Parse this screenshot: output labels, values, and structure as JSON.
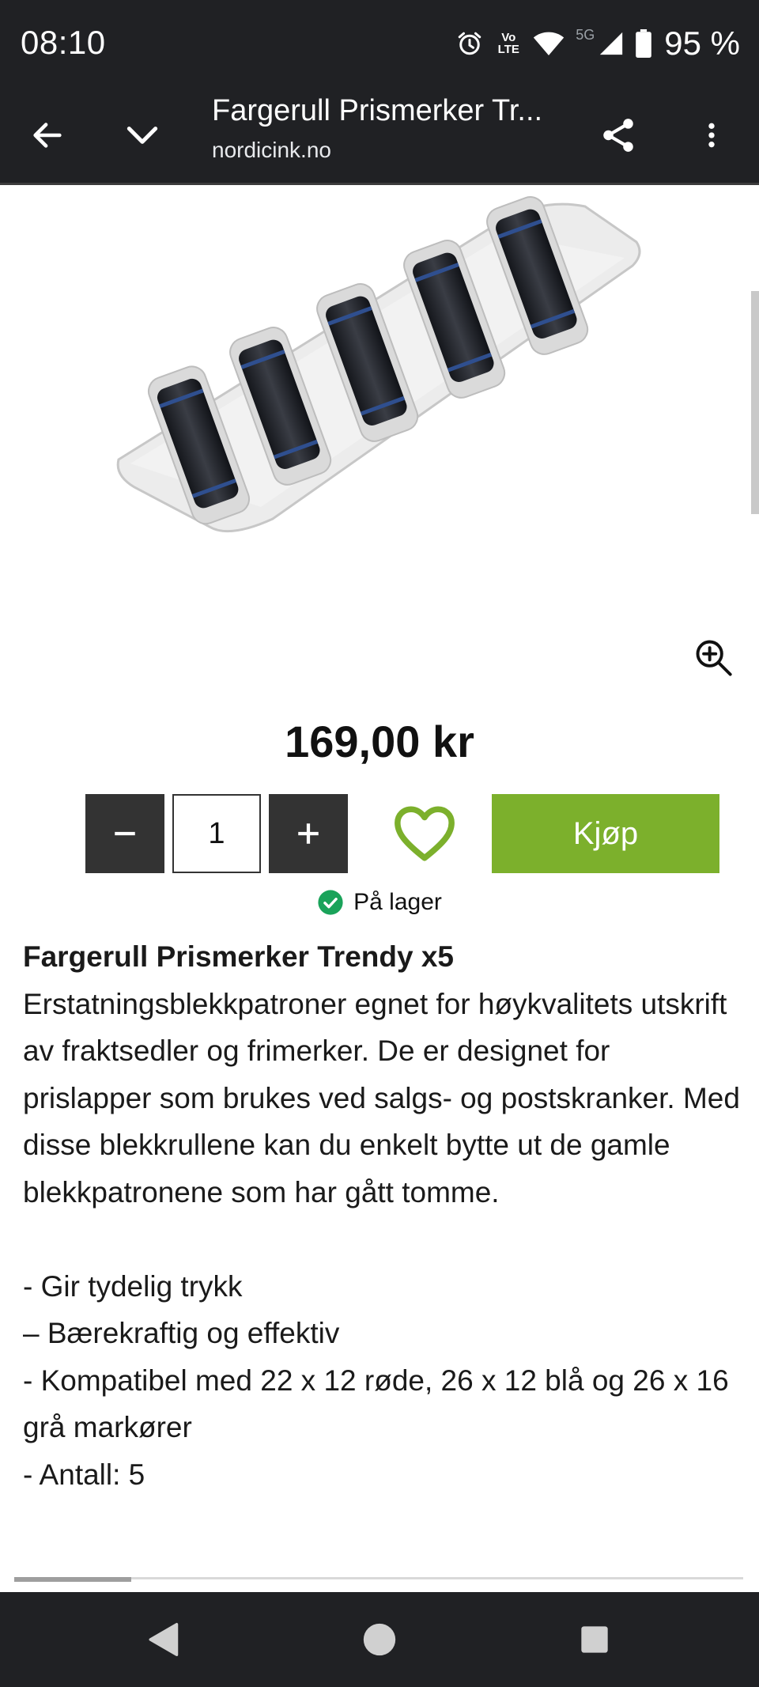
{
  "status_bar": {
    "time": "08:10",
    "network": "5G",
    "volte": "Vo LTE",
    "battery": "95 %"
  },
  "toolbar": {
    "title": "Fargerull Prismerker Tr...",
    "url": "nordicink.no"
  },
  "product": {
    "price": "169,00 kr",
    "quantity": "1",
    "buy_label": "Kjøp",
    "stock_label": "På lager",
    "image_alt": "Fargerull Prismerker Trendy x5"
  },
  "description": {
    "title": "Fargerull Prismerker Trendy x5",
    "paragraph": "Erstatningsblekkpatroner egnet for høykvalitets utskrift av fraktsedler og frimerker. De er designet for prislapper som brukes ved salgs- og postskranker. Med disse blekkrullene kan du enkelt bytte ut de gamle blekkpatronene som har gått tomme.",
    "bullets": [
      "- Gir tydelig trykk",
      "– Bærekraftig og effektiv",
      "- Kompatibel med 22 x 12 røde, 26 x 12 blå og 26 x 16 grå markører",
      "- Antall: 5"
    ]
  },
  "colors": {
    "buy_button": "#7cb02c",
    "wishlist": "#7cb02c",
    "stock_ok": "#1aa35a",
    "chrome": "#202124"
  },
  "icons": {
    "back": "arrow-left-icon",
    "collapse": "chevron-down-icon",
    "share": "share-icon",
    "menu": "more-vertical-icon",
    "zoom": "zoom-in-icon",
    "wishlist": "heart-icon",
    "stock": "check-circle-icon"
  }
}
